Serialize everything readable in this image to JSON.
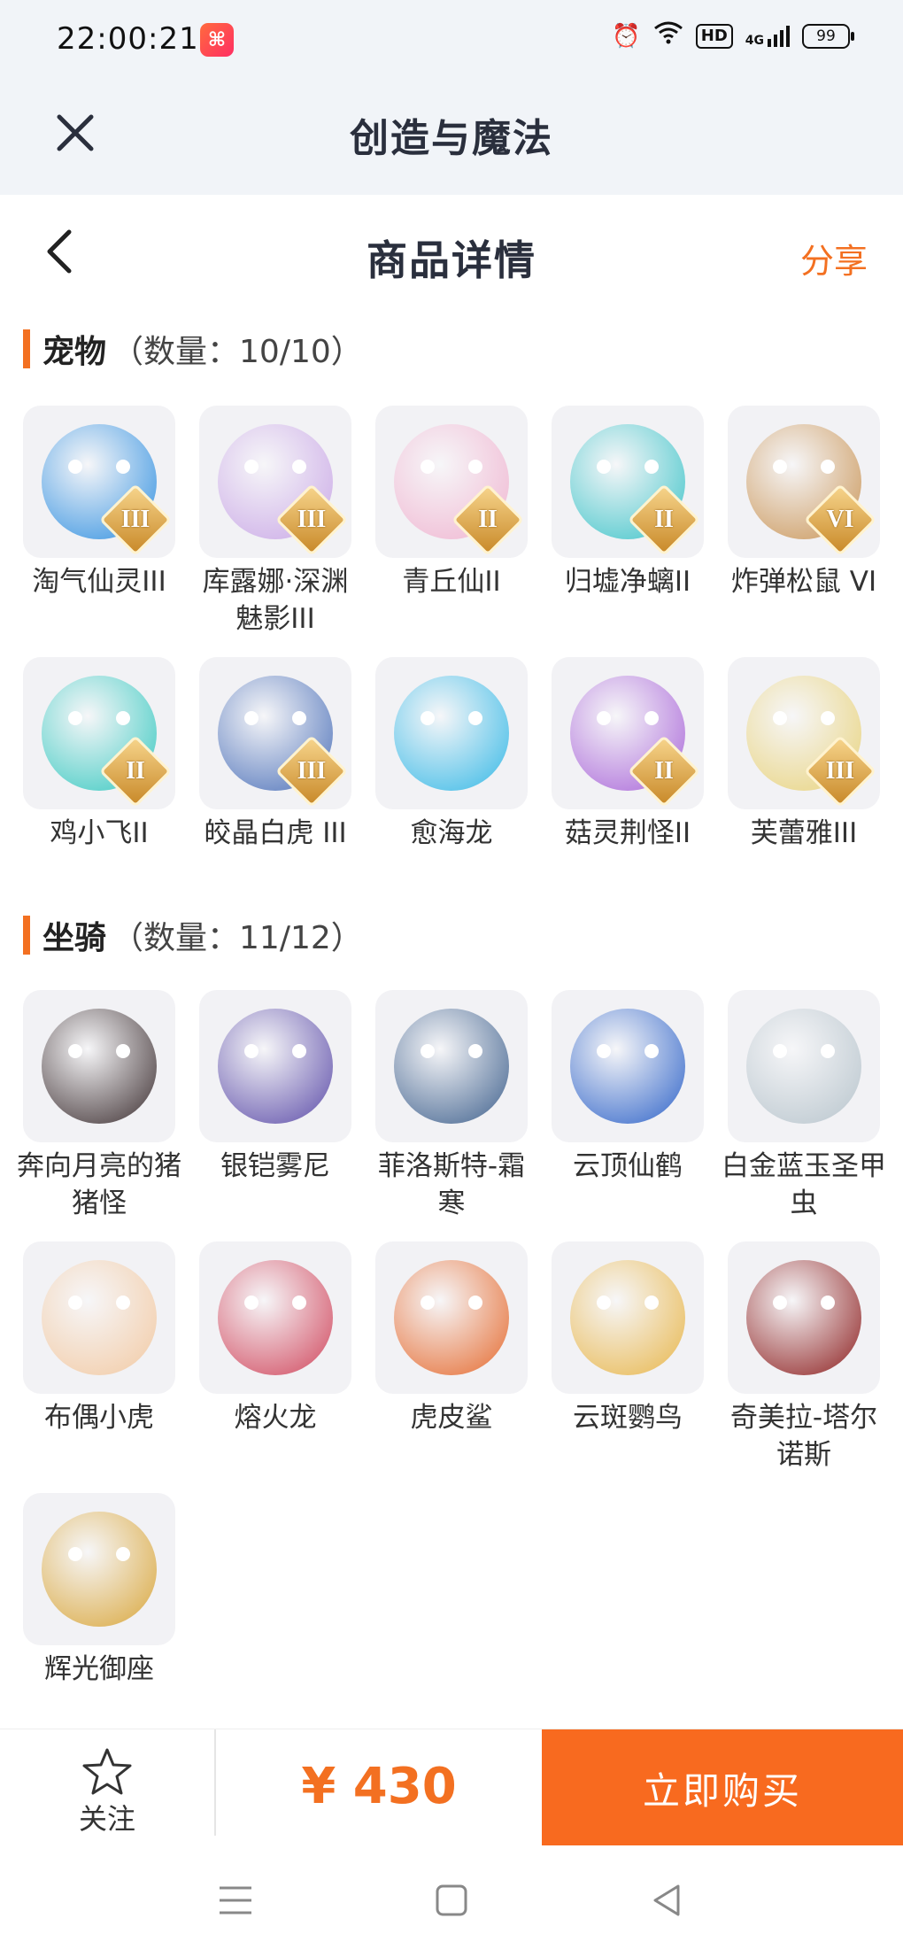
{
  "status": {
    "time": "22:00:21",
    "app_badge": "⌘",
    "hd": "HD",
    "network": "4G",
    "battery": "99"
  },
  "app": {
    "title": "创造与魔法"
  },
  "nav": {
    "title": "商品详情",
    "share": "分享"
  },
  "pets": {
    "title": "宠物",
    "count": "（数量：10/10）",
    "items": [
      {
        "name": "淘气仙灵III",
        "rank": "III",
        "color": "#2f8fe0"
      },
      {
        "name": "库露娜·深渊魅影III",
        "rank": "III",
        "color": "#c9a7e6"
      },
      {
        "name": "青丘仙II",
        "rank": "II",
        "color": "#f0b4d0"
      },
      {
        "name": "归墟净螭II",
        "rank": "II",
        "color": "#3bc3c8"
      },
      {
        "name": "炸弹松鼠 VI",
        "rank": "VI",
        "color": "#c99455"
      },
      {
        "name": "鸡小飞II",
        "rank": "II",
        "color": "#36c8c0"
      },
      {
        "name": "皎晶白虎 III",
        "rank": "III",
        "color": "#4a6fb8"
      },
      {
        "name": "愈海龙",
        "rank": "",
        "color": "#34b8e6"
      },
      {
        "name": "菇灵荆怪II",
        "rank": "II",
        "color": "#a864d8"
      },
      {
        "name": "芙蕾雅III",
        "rank": "III",
        "color": "#e8d27a"
      }
    ]
  },
  "mounts": {
    "title": "坐骑",
    "count": "（数量：11/12）",
    "items": [
      {
        "name": "奔向月亮的猪猪怪",
        "color": "#3b2d2f"
      },
      {
        "name": "银铠雾尼",
        "color": "#5b4ba8"
      },
      {
        "name": "菲洛斯特-霜寒",
        "color": "#3d5f8c"
      },
      {
        "name": "云顶仙鹤",
        "color": "#2d62c8"
      },
      {
        "name": "白金蓝玉圣甲虫",
        "color": "#b7c4cc"
      },
      {
        "name": "布偶小虎",
        "color": "#f2c9a2"
      },
      {
        "name": "熔火龙",
        "color": "#d0455b"
      },
      {
        "name": "虎皮鲨",
        "color": "#e5692d"
      },
      {
        "name": "云斑鹦鸟",
        "color": "#e8b64a"
      },
      {
        "name": "奇美拉-塔尔诺斯",
        "color": "#8c1d1d"
      },
      {
        "name": "辉光御座",
        "color": "#d9a63a"
      }
    ]
  },
  "footer": {
    "follow": "关注",
    "price": "¥ 430",
    "buy": "立即购买"
  },
  "colors": {
    "accent": "#f37021",
    "buy_bg": "#f86a1f",
    "header_bg": "#f1f4f8"
  }
}
